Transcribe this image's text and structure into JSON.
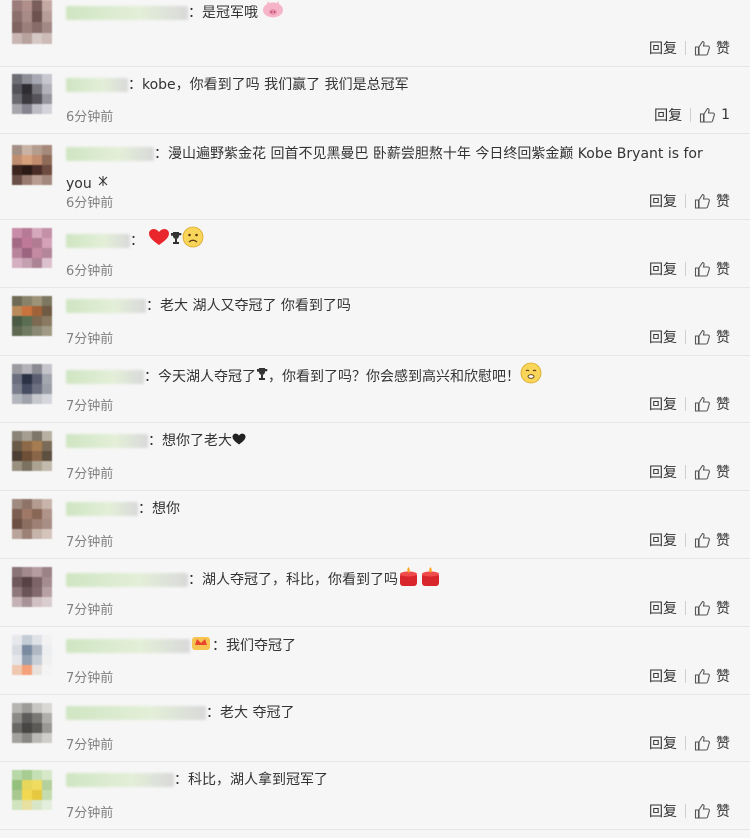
{
  "reply_label": "回复",
  "like_label": "赞",
  "comments": [
    {
      "text": "是冠军哦",
      "time": "",
      "likes": "赞"
    },
    {
      "text": "kobe，你看到了吗 我们赢了 我们是总冠军",
      "time": "6分钟前",
      "likes": "1"
    },
    {
      "text": "漫山遍野紫金花 回首不见黑曼巴 卧薪尝胆熬十年 今日终回紫金巅 Kobe Bryant is for you",
      "time": "6分钟前",
      "likes": "赞"
    },
    {
      "text": "",
      "time": "6分钟前",
      "likes": "赞"
    },
    {
      "text": "老大 湖人又夺冠了 你看到了吗",
      "time": "7分钟前",
      "likes": "赞"
    },
    {
      "text": "今天湖人夺冠了",
      "text2": "，你看到了吗？你会感到高兴和欣慰吧！",
      "time": "7分钟前",
      "likes": "赞"
    },
    {
      "text": "想你了老大",
      "time": "7分钟前",
      "likes": "赞"
    },
    {
      "text": "想你",
      "time": "7分钟前",
      "likes": "赞"
    },
    {
      "text": "湖人夺冠了，科比，你看到了吗",
      "time": "7分钟前",
      "likes": "赞"
    },
    {
      "text": "我们夺冠了",
      "time": "7分钟前",
      "likes": "赞"
    },
    {
      "text": "老大 夺冠了",
      "time": "7分钟前",
      "likes": "赞"
    },
    {
      "text": "科比，湖人拿到冠军了",
      "time": "7分钟前",
      "likes": "赞"
    }
  ]
}
